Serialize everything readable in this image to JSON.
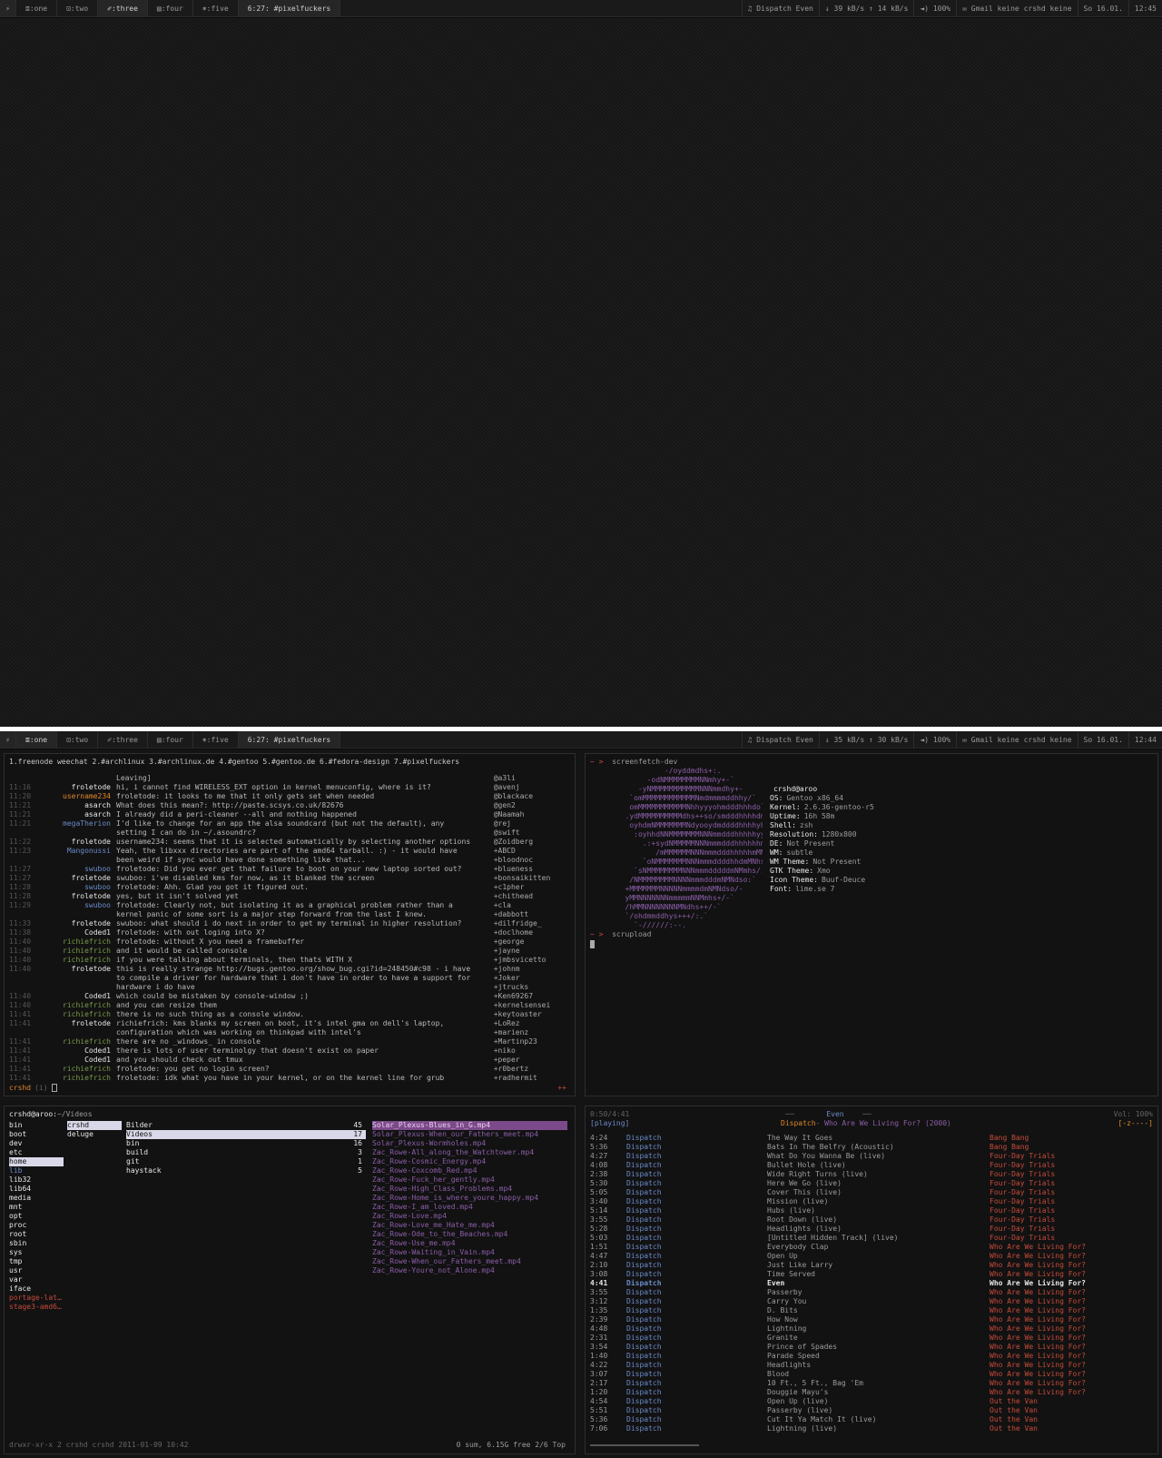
{
  "bar1": {
    "arch": "⚡",
    "tags": [
      "≣:one",
      "⊡:two",
      "✐:three",
      "▤:four",
      "⎈:five"
    ],
    "active_tag": 2,
    "title": "6:27: #pixelfuckers",
    "music_icon": "headphones-icon",
    "music": "Dispatch Even",
    "down": "39 kB/s",
    "up": "14 kB/s",
    "volume": "100%",
    "mail": "Gmail keine crshd keine",
    "date": "So 16.01.",
    "time": "12:45"
  },
  "bar2": {
    "arch": "⚡",
    "tags": [
      "≣:one",
      "⊡:two",
      "✐:three",
      "▤:four",
      "⎈:five"
    ],
    "active_tag": 0,
    "title": "6:27: #pixelfuckers",
    "music": "Dispatch Even",
    "down": "35 kB/s",
    "up": "30 kB/s",
    "volume": "100%",
    "mail": "Gmail keine crshd keine",
    "date": "So 16.01.",
    "time": "12:44"
  },
  "weechat": {
    "tabs": "1.freenode weechat 2.#archlinux 3.#archlinux.de 4.#gentoo 5.#gentoo.de 6.#fedora-design 7.#pixelfuckers",
    "lines": [
      [
        "",
        "",
        "Leaving]"
      ],
      [
        "11:16",
        "froletode",
        "hi, i cannot find WIRELESS_EXT option in kernel menuconfig, where is it?"
      ],
      [
        "11:20",
        "username234",
        "froletode: it looks to me that it only gets set when needed"
      ],
      [
        "11:21",
        "asarch",
        "What does this mean?: http://paste.scsys.co.uk/82676"
      ],
      [
        "11:21",
        "asarch",
        "I already did a peri-cleaner --all and nothing happened"
      ],
      [
        "11:21",
        "megaTherion",
        "I'd like to change for an app the alsa soundcard (but not the default), any"
      ],
      [
        "",
        "",
        "setting I can do in ~/.asoundrc?"
      ],
      [
        "11:22",
        "froletode",
        "username234: seems that it is selected automatically by selecting another options"
      ],
      [
        "11:23",
        "Mangonussi",
        "Yeah, the libxxx directories are part of the amd64 tarball. :) - it would have"
      ],
      [
        "",
        "",
        "been weird if sync would have done something like that..."
      ],
      [
        "11:27",
        "swuboo",
        "froletode: Did you ever get that failure to boot on your new laptop sorted out?"
      ],
      [
        "11:27",
        "froletode",
        "swuboo: i've disabled kms for now, as it blanked the screen"
      ],
      [
        "11:28",
        "swuboo",
        "froletode: Ahh.  Glad you got it figured out."
      ],
      [
        "11:28",
        "froletode",
        "yes, but it isn't solved yet"
      ],
      [
        "11:29",
        "swuboo",
        "froletode: Clearly not, but isolating it as a graphical problem rather than a"
      ],
      [
        "",
        "",
        "kernel panic of some sort is a major step forward from the last I knew."
      ],
      [
        "11:33",
        "froletode",
        "swuboo: what should i do next in order to get my terminal in higher resolution?"
      ],
      [
        "11:38",
        "Coded1",
        "froletode: with out loging into X?"
      ],
      [
        "11:40",
        "richiefrich",
        "froletode: without X you need a framebuffer"
      ],
      [
        "11:40",
        "richiefrich",
        "and it would be called console"
      ],
      [
        "11:40",
        "richiefrich",
        "if you were talking about terminals, then thats WITH X"
      ],
      [
        "11:40",
        "froletode",
        "this is really strange http://bugs.gentoo.org/show_bug.cgi?id=248450#c98 - i have"
      ],
      [
        "",
        "",
        "to compile a driver for hardware that i don't have in order to have a support for"
      ],
      [
        "",
        "",
        "hardware i do have"
      ],
      [
        "11:40",
        "Coded1",
        "which could be mistaken by console-window ;)"
      ],
      [
        "11:40",
        "richiefrich",
        "and you can resize them"
      ],
      [
        "11:41",
        "richiefrich",
        "there is no such thing as a console window."
      ],
      [
        "11:41",
        "froletode",
        "richiefrich: kms blanks my screen on boot, it's intel gma on dell's laptop,"
      ],
      [
        "",
        "",
        "configuration which was working on thinkpad with intel's"
      ],
      [
        "11:41",
        "richiefrich",
        "there are no _windows_ in console"
      ],
      [
        "11:41",
        "Coded1",
        "there is lots of user terminolgy that doesn't exist on paper"
      ],
      [
        "11:41",
        "Coded1",
        "and you should check out tmux"
      ],
      [
        "11:41",
        "richiefrich",
        "froletode: you get no login screen?"
      ],
      [
        "11:41",
        "richiefrich",
        "froletode: idk what you have in your kernel, or on the kernel line for grub"
      ]
    ],
    "nicks": [
      "@a3li",
      "@avenj",
      "@blackace",
      "@gen2",
      "@Naamah",
      "@rej",
      "@swift",
      "@Zoidberg",
      "+ABCD",
      "+bloodnoc",
      "+blueness",
      "+bonsaikitten",
      "+c1pher",
      "+chithead",
      "+cla",
      "+dabbott",
      "+dilfridge_",
      "+doclhome",
      "+george",
      "+jayne",
      "+jmbsvicetto",
      "+johnm",
      "+Joker",
      "+jtrucks",
      "+Ken69267",
      "+kernelsensei",
      "+keytoaster",
      "+LoRez",
      "+marienz",
      "+Martinp23",
      "+niko",
      "+peper",
      "+r0bertz",
      "+radhermit"
    ],
    "prompt": "crshd",
    "prompt_mode": "(i)",
    "activity": "++"
  },
  "screenfetch": {
    "cmd1": "screenfetch-dev",
    "cmd2": "scrupload",
    "prompt": "~ >",
    "art": [
      "                 -/oyddmdhs+:.",
      "             -odNMMMMMMMMNNmhy+-`",
      "           -yNMMMMMMMMMMMNNNmmdhy+-",
      "         `omMMMMMMMMMMMMNmdmmmmddhhy/`",
      "         omMMMMMMMMMMMNhhyyyohmdddhhhdo`",
      "        .ydMMMMMMMMMMdhs++so/smdddhhhhdm+`",
      "         oyhdmNMMMMMMMNdyooydmddddhhhhyhNd.",
      "          :oyhhdNNMMMMMMMNNNmmdddhhhhhyymMh",
      "            .:+sydNMMMMMNNNmmmdddhhhhhhmMmy",
      "               /mMMMMMMNNNmmmdddhhhhhmMNhs:",
      "            `oNMMMMMMMNNNmmmddddhhdmMNhs+`",
      "          `sNMMMMMMMMNNNmmmdddddmNMmhs/.",
      "         /NMMMMMMMMNNNNmmmdddmNMNdso:`",
      "        +MMMMMMMNNNNNmmmmdmNMNdso/-",
      "        yMMNNNNNNNmmmmmNNMmhs+/-`",
      "        /hMMNNNNNNNNMNdhs++/-`",
      "        `/ohdmmddhys+++/:.`",
      "          `-//////:--."
    ],
    "info": [
      [
        "",
        "crshd@aroo"
      ],
      [
        "OS:",
        "Gentoo x86_64"
      ],
      [
        "Kernel:",
        "2.6.36-gentoo-r5"
      ],
      [
        "Uptime:",
        "16h 58m"
      ],
      [
        "Shell:",
        "zsh"
      ],
      [
        "Resolution:",
        "1280x800"
      ],
      [
        "DE:",
        "Not Present"
      ],
      [
        "WM:",
        "subtle"
      ],
      [
        "WM Theme:",
        "Not Present"
      ],
      [
        "GTK Theme:",
        "Xmo"
      ],
      [
        "Icon Theme:",
        "Buuf-Deuce"
      ],
      [
        "Font:",
        "lime.se 7"
      ]
    ]
  },
  "ranger": {
    "path_user": "crshd@aroo:",
    "path": "~/Videos",
    "col1": [
      "bin",
      "boot",
      "dev",
      "etc",
      "home",
      "lib",
      "lib32",
      "lib64",
      "media",
      "mnt",
      "opt",
      "proc",
      "root",
      "sbin",
      "sys",
      "tmp",
      "usr",
      "var",
      "iface",
      "portage-lat…",
      "stage3-amd6…"
    ],
    "col2": [
      "crshd",
      "deluge"
    ],
    "col3": [
      [
        "Bilder",
        "45"
      ],
      [
        "Videos",
        "17"
      ],
      [
        "bin",
        "16"
      ],
      [
        "build",
        "3"
      ],
      [
        "git",
        "1"
      ],
      [
        "haystack",
        "5"
      ]
    ],
    "col4": [
      "Solar_Plexus-Blues_in_G.mp4",
      "Solar_Plexus-When_our_Fathers_meet.mp4",
      "Solar_Plexus-Wormholes.mp4",
      "Zac_Rowe-All_along_the_Watchtower.mp4",
      "Zac_Rowe-Cosmic_Energy.mp4",
      "Zac_Rowe-Coxcomb_Red.mp4",
      "Zac_Rowe-Fuck_her_gently.mp4",
      "Zac_Rowe-High_Class_Problems.mp4",
      "Zac_Rowe-Home_is_where_youre_happy.mp4",
      "Zac_Rowe-I_am_loved.mp4",
      "Zac_Rowe-Love.mp4",
      "Zac_Rowe-Love_me_Hate_me.mp4",
      "Zac_Rowe-Ode_to_the_Beaches.mp4",
      "Zac_Rowe-Use_me.mp4",
      "Zac_Rowe-Waiting_in_Vain.mp4",
      "Zac_Rowe-When_our_Fathers_meet.mp4",
      "Zac_Rowe-Youre_not_Alone.mp4"
    ],
    "status_left": "drwxr-xr-x 2 crshd crshd 2011-01-09 10:42",
    "status_right": "0 sum, 6.15G free  2/6  Top"
  },
  "ncmpcpp": {
    "elapsed": "0:50/4:41",
    "state": "[playing]",
    "title": "Even",
    "artist": "Dispatch",
    "album_line": " - Who Are We Living For? (2000)",
    "volume": "Vol: 100%",
    "flags": "[-z----]",
    "tracks": [
      [
        "4:24",
        "Dispatch",
        "The Way It Goes",
        "Bang Bang"
      ],
      [
        "5:36",
        "Dispatch",
        "Bats In The Belfry (Acoustic)",
        "Bang Bang"
      ],
      [
        "4:27",
        "Dispatch",
        "What Do You Wanna Be (live)",
        "Four-Day Trials"
      ],
      [
        "4:08",
        "Dispatch",
        "Bullet Hole (live)",
        "Four-Day Trials"
      ],
      [
        "2:38",
        "Dispatch",
        "Wide Right Turns (live)",
        "Four-Day Trials"
      ],
      [
        "5:30",
        "Dispatch",
        "Here We Go (live)",
        "Four-Day Trials"
      ],
      [
        "5:05",
        "Dispatch",
        "Cover This (live)",
        "Four-Day Trials"
      ],
      [
        "3:40",
        "Dispatch",
        "Mission (live)",
        "Four-Day Trials"
      ],
      [
        "5:14",
        "Dispatch",
        "Hubs (live)",
        "Four-Day Trials"
      ],
      [
        "3:55",
        "Dispatch",
        "Root Down (live)",
        "Four-Day Trials"
      ],
      [
        "5:28",
        "Dispatch",
        "Headlights (live)",
        "Four-Day Trials"
      ],
      [
        "5:03",
        "Dispatch",
        "[Untitled Hidden Track] (live)",
        "Four-Day Trials"
      ],
      [
        "1:51",
        "Dispatch",
        "Everybody Clap",
        "Who Are We Living For?"
      ],
      [
        "4:47",
        "Dispatch",
        "Open Up",
        "Who Are We Living For?"
      ],
      [
        "2:10",
        "Dispatch",
        "Just Like Larry",
        "Who Are We Living For?"
      ],
      [
        "3:08",
        "Dispatch",
        "Time Served",
        "Who Are We Living For?"
      ],
      [
        "4:41",
        "Dispatch",
        "Even",
        "Who Are We Living For?"
      ],
      [
        "3:55",
        "Dispatch",
        "Passerby",
        "Who Are We Living For?"
      ],
      [
        "3:12",
        "Dispatch",
        "Carry You",
        "Who Are We Living For?"
      ],
      [
        "1:35",
        "Dispatch",
        "D. Bits",
        "Who Are We Living For?"
      ],
      [
        "2:39",
        "Dispatch",
        "How Now",
        "Who Are We Living For?"
      ],
      [
        "4:48",
        "Dispatch",
        "Lightning",
        "Who Are We Living For?"
      ],
      [
        "2:31",
        "Dispatch",
        "Granite",
        "Who Are We Living For?"
      ],
      [
        "3:54",
        "Dispatch",
        "Prince of Spades",
        "Who Are We Living For?"
      ],
      [
        "1:40",
        "Dispatch",
        "Parade Speed",
        "Who Are We Living For?"
      ],
      [
        "4:22",
        "Dispatch",
        "Headlights",
        "Who Are We Living For?"
      ],
      [
        "3:07",
        "Dispatch",
        "Blood",
        "Who Are We Living For?"
      ],
      [
        "2:17",
        "Dispatch",
        "10 Ft., 5 Ft., Bag 'Em",
        "Who Are We Living For?"
      ],
      [
        "1:20",
        "Dispatch",
        "Douggie Mayu's",
        "Who Are We Living For?"
      ],
      [
        "4:54",
        "Dispatch",
        "Open Up (live)",
        "Out the Van"
      ],
      [
        "5:51",
        "Dispatch",
        "Passerby (live)",
        "Out the Van"
      ],
      [
        "5:36",
        "Dispatch",
        "Cut It Ya Match It (live)",
        "Out the Van"
      ],
      [
        "7:06",
        "Dispatch",
        "Lightning (live)",
        "Out the Van"
      ]
    ]
  }
}
